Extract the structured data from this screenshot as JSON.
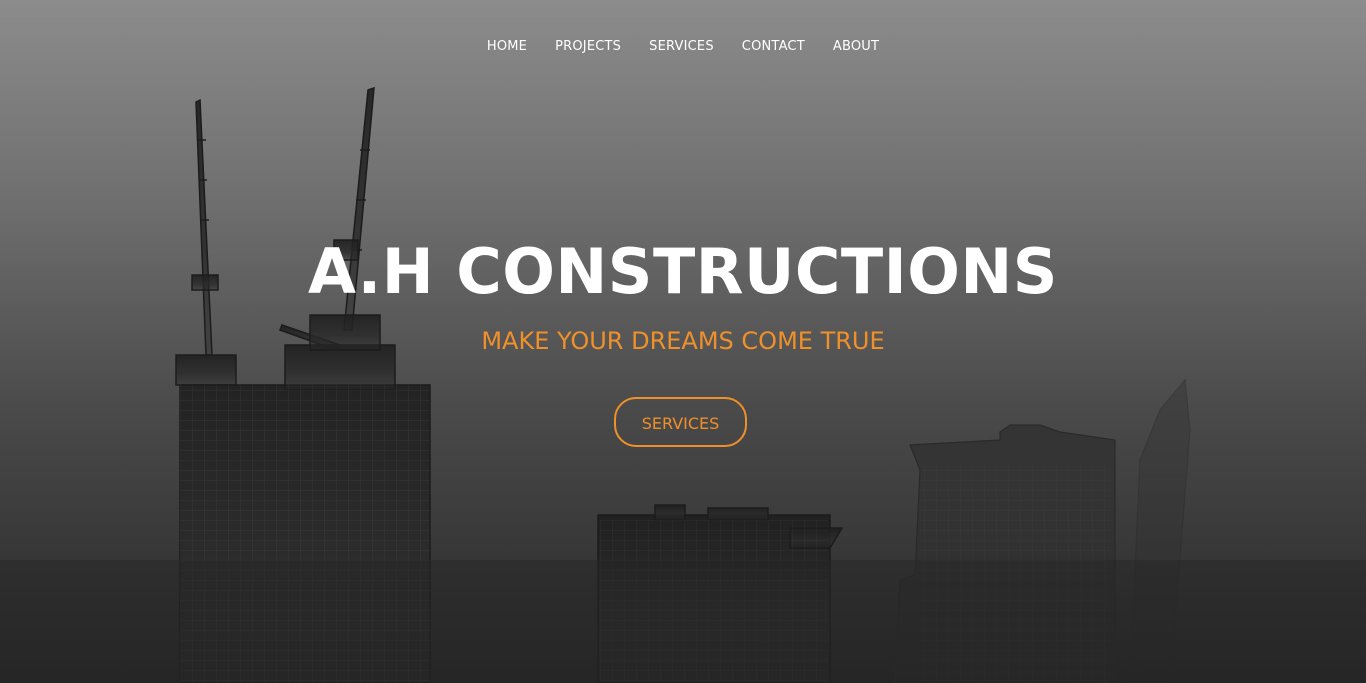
{
  "nav": {
    "items": [
      {
        "label": "HOME"
      },
      {
        "label": "PROJECTS"
      },
      {
        "label": "SERVICES"
      },
      {
        "label": "CONTACT"
      },
      {
        "label": "ABOUT"
      }
    ]
  },
  "hero": {
    "title": "A.H CONSTRUCTIONS",
    "tagline": "MAKE YOUR DREAMS COME TRUE",
    "cta_label": "SERVICES",
    "background_image": "construction-skyline-with-cranes"
  },
  "colors": {
    "accent": "#f0902a",
    "text": "#ffffff",
    "background_top": "#8c8c8c",
    "background_bottom": "#262626"
  }
}
